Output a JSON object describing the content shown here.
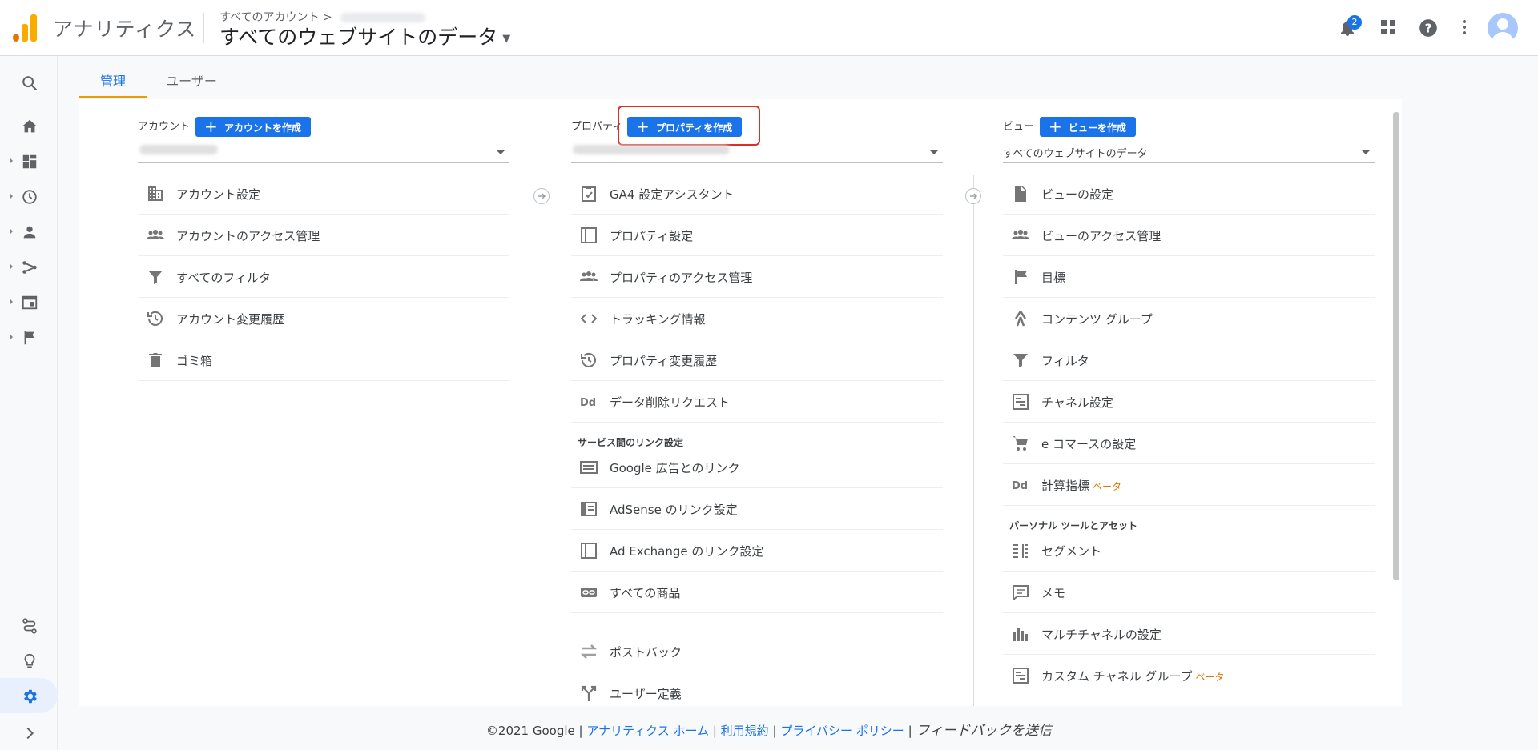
{
  "header": {
    "app_name": "アナリティクス",
    "breadcrumb": "すべてのアカウント >",
    "title": "すべてのウェブサイトのデータ",
    "notification_count": "2"
  },
  "tabs": [
    {
      "label": "管理",
      "active": true
    },
    {
      "label": "ユーザー",
      "active": false
    }
  ],
  "account": {
    "heading": "アカウント",
    "create_label": "アカウントを作成",
    "items": [
      {
        "label": "アカウント設定",
        "icon": "building-icon"
      },
      {
        "label": "アカウントのアクセス管理",
        "icon": "people-icon"
      },
      {
        "label": "すべてのフィルタ",
        "icon": "filter-icon"
      },
      {
        "label": "アカウント変更履歴",
        "icon": "history-icon"
      },
      {
        "label": "ゴミ箱",
        "icon": "trash-icon"
      }
    ]
  },
  "property": {
    "heading": "プロパティ",
    "create_label": "プロパティを作成",
    "items": [
      {
        "label": "GA4 設定アシスタント",
        "icon": "checklist-icon"
      },
      {
        "label": "プロパティ設定",
        "icon": "square-icon"
      },
      {
        "label": "プロパティのアクセス管理",
        "icon": "people-icon"
      },
      {
        "label": "トラッキング情報",
        "icon": "code-icon"
      },
      {
        "label": "プロパティ変更履歴",
        "icon": "history-icon"
      },
      {
        "label": "データ削除リクエスト",
        "icon": "dd-icon"
      }
    ],
    "section_label": "サービス間のリンク設定",
    "link_items": [
      {
        "label": "Google 広告とのリンク",
        "icon": "ads-icon"
      },
      {
        "label": "AdSense のリンク設定",
        "icon": "adsense-icon"
      },
      {
        "label": "Ad Exchange のリンク設定",
        "icon": "square-icon"
      },
      {
        "label": "すべての商品",
        "icon": "link-icon"
      }
    ],
    "extra_items": [
      {
        "label": "ポストバック",
        "icon": "swap-icon"
      },
      {
        "label": "ユーザー定義",
        "icon": "fork-icon"
      }
    ]
  },
  "view": {
    "heading": "ビュー",
    "create_label": "ビューを作成",
    "selected": "すべてのウェブサイトのデータ",
    "items": [
      {
        "label": "ビューの設定",
        "icon": "file-icon"
      },
      {
        "label": "ビューのアクセス管理",
        "icon": "people-icon"
      },
      {
        "label": "目標",
        "icon": "flag-icon"
      },
      {
        "label": "コンテンツ グループ",
        "icon": "person-walk-icon"
      },
      {
        "label": "フィルタ",
        "icon": "filter-icon"
      },
      {
        "label": "チャネル設定",
        "icon": "channel-icon"
      },
      {
        "label": "e コマースの設定",
        "icon": "cart-icon"
      },
      {
        "label": "計算指標",
        "beta": "ベータ",
        "icon": "dd-icon"
      }
    ],
    "section_label": "パーソナル ツールとアセット",
    "tool_items": [
      {
        "label": "セグメント",
        "icon": "segment-icon"
      },
      {
        "label": "メモ",
        "icon": "comment-icon"
      },
      {
        "label": "マルチチャネルの設定",
        "icon": "bars-icon"
      },
      {
        "label": "カスタム チャネル グループ",
        "beta": "ベータ",
        "icon": "channel-icon"
      }
    ]
  },
  "footer": {
    "copyright": "©2021 Google",
    "sep": "|",
    "home_link": "アナリティクス ホーム",
    "terms_link": "利用規約",
    "privacy_link": "プライバシー ポリシー",
    "feedback": "フィードバックを送信"
  },
  "colors": {
    "accent": "#1a73e8",
    "highlight": "#d93025",
    "logo_orange": "#f9ab00",
    "logo_dark": "#e37400"
  }
}
